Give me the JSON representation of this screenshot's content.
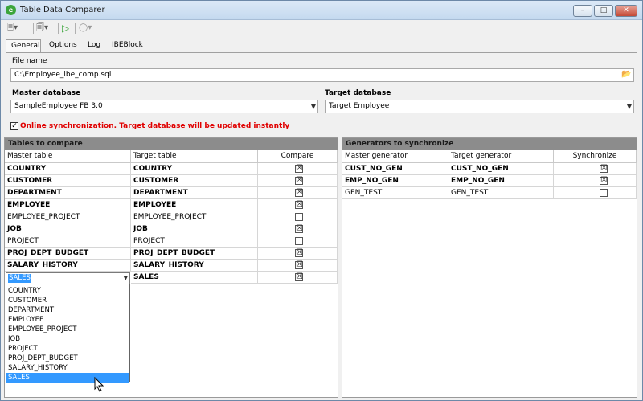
{
  "window": {
    "title": "Table Data Comparer"
  },
  "tabs": [
    {
      "label": "General"
    },
    {
      "label": "Options"
    },
    {
      "label": "Log"
    },
    {
      "label": "IBEBlock"
    }
  ],
  "file": {
    "label": "File name",
    "value": "C:\\Employee_ibe_comp.sql"
  },
  "master_db": {
    "label": "Master database",
    "value": "SampleEmployee FB 3.0"
  },
  "target_db": {
    "label": "Target database",
    "value": "Target Employee"
  },
  "online_sync": {
    "label": "Online synchronization. Target database will be updated instantly",
    "checked": true
  },
  "tables": {
    "title": "Tables to compare",
    "headers": {
      "master": "Master table",
      "target": "Target table",
      "compare": "Compare"
    },
    "rows": [
      {
        "master": "COUNTRY",
        "target": "COUNTRY",
        "compare": true
      },
      {
        "master": "CUSTOMER",
        "target": "CUSTOMER",
        "compare": true
      },
      {
        "master": "DEPARTMENT",
        "target": "DEPARTMENT",
        "compare": true
      },
      {
        "master": "EMPLOYEE",
        "target": "EMPLOYEE",
        "compare": true
      },
      {
        "master": "EMPLOYEE_PROJECT",
        "target": "EMPLOYEE_PROJECT",
        "compare": false
      },
      {
        "master": "JOB",
        "target": "JOB",
        "compare": true
      },
      {
        "master": "PROJECT",
        "target": "PROJECT",
        "compare": false
      },
      {
        "master": "PROJ_DEPT_BUDGET",
        "target": "PROJ_DEPT_BUDGET",
        "compare": true
      },
      {
        "master": "SALARY_HISTORY",
        "target": "SALARY_HISTORY",
        "compare": true
      },
      {
        "master": "SALES",
        "target": "SALES",
        "compare": true
      }
    ],
    "dropdown_options": [
      "COUNTRY",
      "CUSTOMER",
      "DEPARTMENT",
      "EMPLOYEE",
      "EMPLOYEE_PROJECT",
      "JOB",
      "PROJECT",
      "PROJ_DEPT_BUDGET",
      "SALARY_HISTORY",
      "SALES"
    ],
    "dropdown_selected": "SALES"
  },
  "generators": {
    "title": "Generators to synchronize",
    "headers": {
      "master": "Master generator",
      "target": "Target generator",
      "sync": "Synchronize"
    },
    "rows": [
      {
        "master": "CUST_NO_GEN",
        "target": "CUST_NO_GEN",
        "sync": true
      },
      {
        "master": "EMP_NO_GEN",
        "target": "EMP_NO_GEN",
        "sync": true
      },
      {
        "master": "GEN_TEST",
        "target": "GEN_TEST",
        "sync": false
      }
    ]
  },
  "icons": {
    "app": "app-icon",
    "folder": "folder-open-icon",
    "run": "play-icon"
  }
}
